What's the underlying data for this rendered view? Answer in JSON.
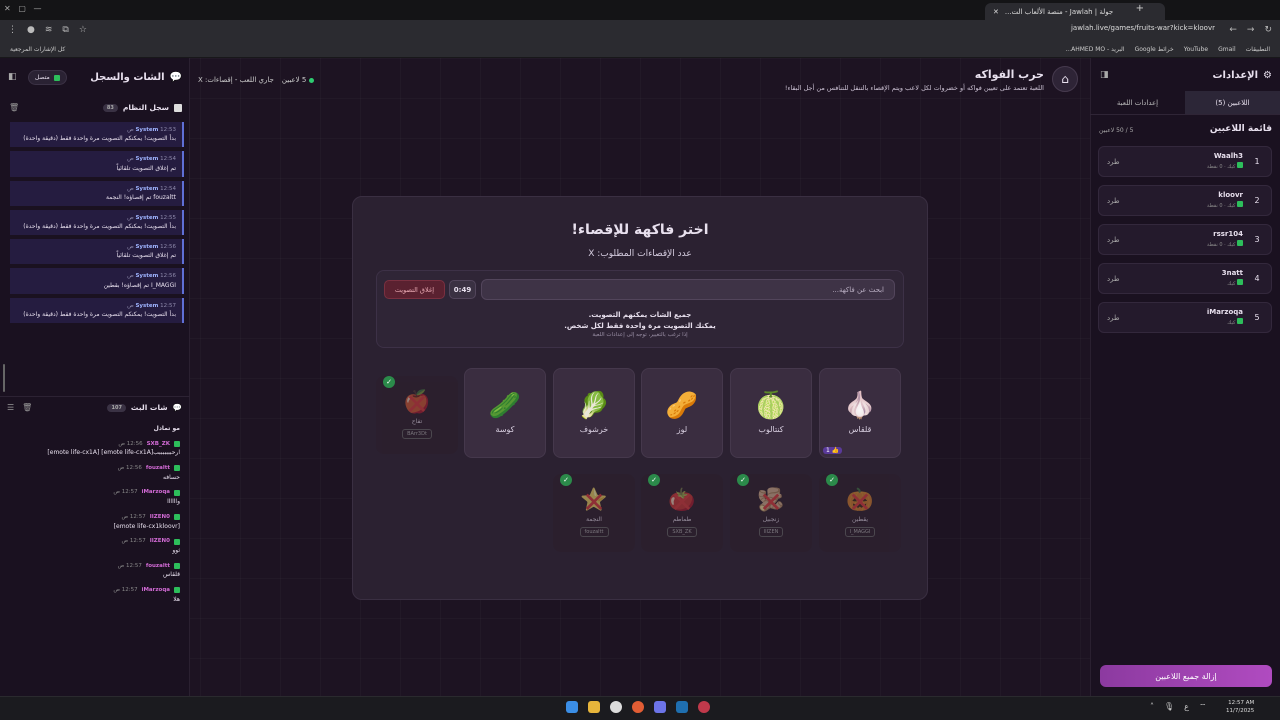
{
  "browser": {
    "tab_title": "جولة | Jawlah - منصة الألعاب الت...",
    "url": "jawlah.live/games/fruits-war?kick=kloovr",
    "bookmarks": [
      "التطبيقات",
      "Gmail",
      "YouTube",
      "خرائط Google",
      "البريد - AHMED MO...",
      "كل الإشارات المرجعية"
    ]
  },
  "header": {
    "title": "حرب الفواكه",
    "subtitle": "اللعبة تعتمد على تعيين فواكه أو خضروات لكل لاعب ويتم الإقصاء بالتنقل للتنافس من أجل البقاء!",
    "players_count": "5 لاعبين",
    "status": "جاري اللعب - إقصاءات: X"
  },
  "left": {
    "title": "الشات والسجل",
    "connected": "متصل",
    "syslog_title": "سجل النظام",
    "syslog_count": "83",
    "syslog": [
      {
        "who": "System",
        "time": "12:53 ص",
        "text": "بدأ التصويت! يمكنكم التصويت مرة واحدة فقط (دقيقة واحدة)"
      },
      {
        "who": "System",
        "time": "12:54 ص",
        "text": "تم إغلاق التصويت تلقائياً"
      },
      {
        "who": "System",
        "time": "12:54 ص",
        "text": "fouzaltt تم إقصاؤه! النجمة"
      },
      {
        "who": "System",
        "time": "12:55 ص",
        "text": "بدأ التصويت! يمكنكم التصويت مرة واحدة فقط (دقيقة واحدة)"
      },
      {
        "who": "System",
        "time": "12:56 ص",
        "text": "تم إغلاق التصويت تلقائياً"
      },
      {
        "who": "System",
        "time": "12:56 ص",
        "text": "I_MAGGI تم إقصاؤه! بقطين"
      },
      {
        "who": "System",
        "time": "12:57 ص",
        "text": "بدأ التصويت! يمكنكم التصويت مرة واحدة فقط (دقيقة واحدة)"
      }
    ],
    "chat_title": "شات البث",
    "chat_count": "107",
    "chat": [
      {
        "who": "",
        "time": "",
        "text": "مو تمادل"
      },
      {
        "who": "SXB_ZK",
        "time": "12:56 ص",
        "text": "ارحبببببببب[emote life-cx1A] [emote life-cx1A]"
      },
      {
        "who": "fouzaltt",
        "time": "12:56 ص",
        "text": "حسافه"
      },
      {
        "who": "iMarzoqa",
        "time": "12:57 ص",
        "text": "واااااا"
      },
      {
        "who": "IIZEN0",
        "time": "12:57 ص",
        "text": "[emote life-cx1kloovr]"
      },
      {
        "who": "IIZEN0",
        "time": "12:57 ص",
        "text": "ثوو"
      },
      {
        "who": "fouzaltt",
        "time": "12:57 ص",
        "text": "قلقاس"
      },
      {
        "who": "iMarzoqa",
        "time": "12:57 ص",
        "text": "هلا"
      }
    ]
  },
  "right": {
    "title": "الإعدادات",
    "tab_players": "اللاعبين (5)",
    "tab_settings": "إعدادات اللعبة",
    "list_title": "قائمة اللاعبين",
    "list_count": "5 / 50 لاعبين",
    "kick_label": "طرد",
    "players": [
      {
        "num": "1",
        "name": "Waalh3",
        "sub": "كيك · 0 نقطة"
      },
      {
        "num": "2",
        "name": "kloovr",
        "sub": "كيك · 0 نقطة"
      },
      {
        "num": "3",
        "name": "rssr104",
        "sub": "كيك · 0 نقطة"
      },
      {
        "num": "4",
        "name": "3natt",
        "sub": "كيك"
      },
      {
        "num": "5",
        "name": "iMarzoqa",
        "sub": "كيك"
      }
    ],
    "remove_all": "إزالة جميع اللاعبين"
  },
  "game": {
    "heading": "اختر فاكهة للإقصاء!",
    "needed": "عدد الإقصاءات المطلوب: X",
    "search_placeholder": "ابحث عن فاكهة...",
    "timer": "0:49",
    "close_vote": "إغلاق التصويت",
    "vote_line1": "جميع الشات يمكنهم التصويت.",
    "vote_line2": "يمكنك التصويت مرة واحدة فقط لكل شخص.",
    "vote_hint": "إذا ترغب بالتغيير، توجه إلى إعدادات اللعبة",
    "fruits": [
      {
        "name": "قلقاس",
        "icon": "🧄",
        "votes": "1"
      },
      {
        "name": "كنتالوب",
        "icon": "🍈",
        "votes": ""
      },
      {
        "name": "لوز",
        "icon": "🥜",
        "votes": ""
      },
      {
        "name": "خرشوف",
        "icon": "🥬",
        "votes": ""
      },
      {
        "name": "كوسة",
        "icon": "🥒",
        "votes": ""
      }
    ],
    "eliminated": [
      {
        "name": "تفاح",
        "icon": "🍎",
        "player": "BArr3Dt"
      },
      {
        "name": "يقطين",
        "icon": "🎃",
        "player": "I_MAGGI"
      },
      {
        "name": "زنجبيل",
        "icon": "🫚",
        "player": "IIIZEN"
      },
      {
        "name": "طماطم",
        "icon": "🍅",
        "player": "SXB_ZK"
      },
      {
        "name": "النجمة",
        "icon": "⭐",
        "player": "fouzaltt"
      }
    ]
  },
  "taskbar": {
    "time": "12:57 AM",
    "date": "11/7/2025",
    "lang": "ع"
  }
}
